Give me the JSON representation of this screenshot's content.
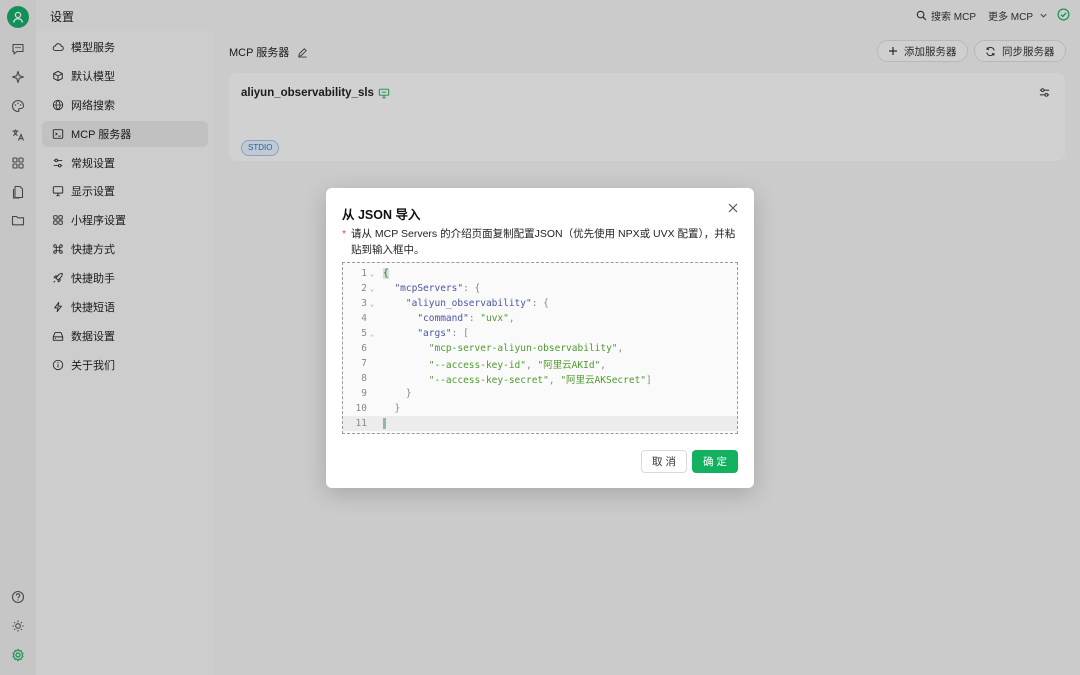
{
  "app": {
    "title": "设置"
  },
  "topbar": {
    "search_label": "搜索 MCP",
    "more_label": "更多 MCP"
  },
  "sidebar": {
    "items": [
      {
        "label": "模型服务",
        "icon": "cloud-icon"
      },
      {
        "label": "默认模型",
        "icon": "cube-icon"
      },
      {
        "label": "网络搜索",
        "icon": "globe-icon"
      },
      {
        "label": "MCP 服务器",
        "icon": "terminal-icon",
        "active": true
      },
      {
        "label": "常规设置",
        "icon": "sliders-icon"
      },
      {
        "label": "显示设置",
        "icon": "monitor-icon"
      },
      {
        "label": "小程序设置",
        "icon": "grid-icon"
      },
      {
        "label": "快捷方式",
        "icon": "command-icon"
      },
      {
        "label": "快捷助手",
        "icon": "rocket-icon"
      },
      {
        "label": "快捷短语",
        "icon": "zap-icon"
      },
      {
        "label": "数据设置",
        "icon": "hard-drive-icon"
      },
      {
        "label": "关于我们",
        "icon": "info-icon"
      }
    ]
  },
  "main": {
    "header_title": "MCP 服务器",
    "add_button": "添加服务器",
    "sync_button": "同步服务器",
    "server_card": {
      "name": "aliyun_observability_sls",
      "tag": "STDIO"
    }
  },
  "dialog": {
    "title": "从 JSON 导入",
    "description": "请从 MCP Servers 的介绍页面复制配置JSON（优先使用 NPX或 UVX 配置），并粘贴到输入框中。",
    "required_mark": "*",
    "cancel_label": "取 消",
    "ok_label": "确 定",
    "code_lines": [
      {
        "n": "1",
        "fold": true
      },
      {
        "n": "2",
        "fold": true,
        "key": "\"mcpServers\"",
        "rest": ": {"
      },
      {
        "n": "3",
        "fold": true,
        "key": "\"aliyun_observability\"",
        "rest": ": {"
      },
      {
        "n": "4",
        "fold": false,
        "key": "\"command\"",
        "sep": ": ",
        "str": "\"uvx\"",
        "rest": ","
      },
      {
        "n": "5",
        "fold": true,
        "key": "\"args\"",
        "rest": ": ["
      },
      {
        "n": "6",
        "fold": false,
        "str": "\"mcp-server-aliyun-observability\"",
        "rest": ","
      },
      {
        "n": "7",
        "fold": false,
        "str": "\"--access-key-id\"",
        "sep2": ", ",
        "str2": "\"阿里云AKId\"",
        "rest": ","
      },
      {
        "n": "8",
        "fold": false,
        "str": "\"--access-key-secret\"",
        "sep2": ", ",
        "str2": "\"阿里云AKSecret\"",
        "rest": "]"
      },
      {
        "n": "9",
        "fold": false,
        "punct": "}"
      },
      {
        "n": "10",
        "fold": false,
        "punct": "}"
      },
      {
        "n": "11",
        "fold": false
      }
    ]
  },
  "colors": {
    "accent": "#12b15f",
    "tag_blue": "#2b72b9"
  }
}
